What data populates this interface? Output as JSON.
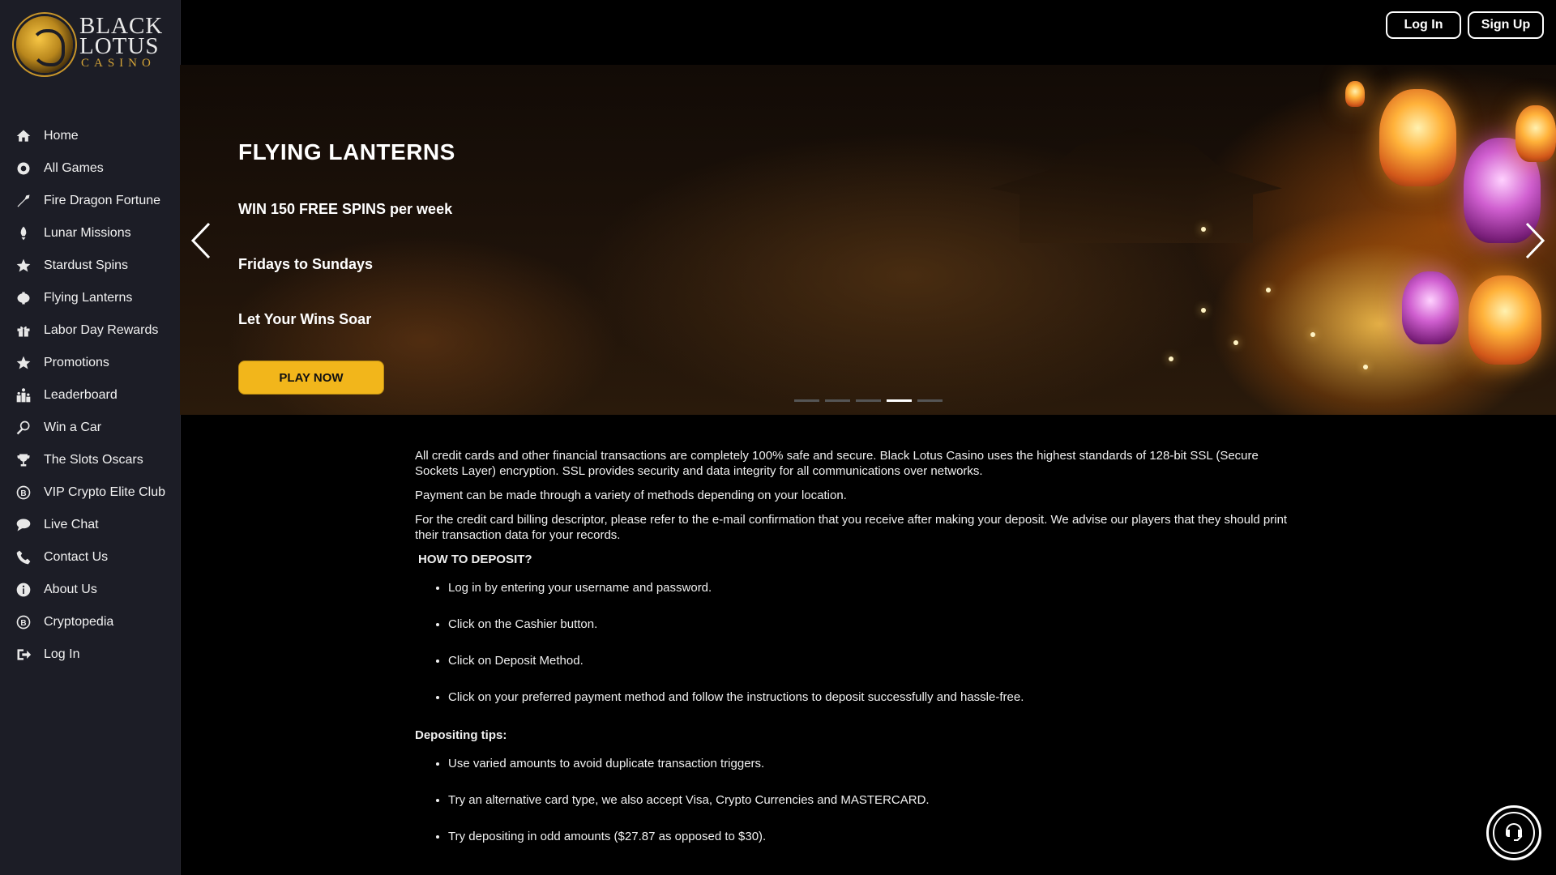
{
  "brand": {
    "name_line1": "BLACK",
    "name_line2": "LOTUS",
    "name_line3": "CASINO"
  },
  "header": {
    "login_label": "Log In",
    "signup_label": "Sign Up"
  },
  "sidebar": {
    "items": [
      {
        "label": "Home",
        "icon": "home-icon"
      },
      {
        "label": "All Games",
        "icon": "games-icon"
      },
      {
        "label": "Fire Dragon Fortune",
        "icon": "dragon-icon"
      },
      {
        "label": "Lunar Missions",
        "icon": "rocket-icon"
      },
      {
        "label": "Stardust Spins",
        "icon": "star-icon"
      },
      {
        "label": "Flying Lanterns",
        "icon": "lantern-icon"
      },
      {
        "label": "Labor Day Rewards",
        "icon": "gift-icon"
      },
      {
        "label": "Promotions",
        "icon": "star-icon"
      },
      {
        "label": "Leaderboard",
        "icon": "leaderboard-icon"
      },
      {
        "label": "Win a Car",
        "icon": "car-icon"
      },
      {
        "label": "The Slots Oscars",
        "icon": "trophy-icon"
      },
      {
        "label": "VIP Crypto Elite Club",
        "icon": "bitcoin-icon"
      },
      {
        "label": "Live Chat",
        "icon": "chat-icon"
      },
      {
        "label": "Contact Us",
        "icon": "phone-icon"
      },
      {
        "label": "About Us",
        "icon": "info-icon"
      },
      {
        "label": "Cryptopedia",
        "icon": "bitcoin-icon"
      },
      {
        "label": "Log In",
        "icon": "login-icon"
      }
    ]
  },
  "hero": {
    "title": "FLYING LANTERNS",
    "line1": "WIN 150 FREE SPINS per week",
    "line2": "Fridays to Sundays",
    "line3": "Let Your Wins Soar",
    "cta_label": "PLAY NOW",
    "slide_count": 5,
    "active_slide": 4
  },
  "content": {
    "para1": "All credit cards and other financial transactions are completely 100% safe and secure. Black Lotus Casino uses the highest standards of 128-bit SSL (Secure Sockets Layer) encryption. SSL provides security and data integrity for all communications over networks.",
    "para2": "Payment can be made through a variety of methods depending on your location.",
    "para3": "For the credit card billing descriptor, please refer to the e-mail confirmation that you receive after making your deposit. We advise our players that they should print their transaction data for your records.",
    "how_heading": "HOW TO DEPOSIT?",
    "steps": [
      "Log in by entering your username and password.",
      "Click on the Cashier button.",
      "Click on Deposit Method.",
      "Click on your preferred payment method and follow the instructions to deposit successfully and hassle-free."
    ],
    "tips_heading": "Depositing tips:",
    "tips": [
      "Use varied amounts to avoid duplicate transaction triggers.",
      "Try an alternative card type, we also accept Visa, Crypto Currencies and MASTERCARD.",
      "Try depositing in odd amounts ($27.87 as opposed to $30)."
    ]
  },
  "colors": {
    "accent": "#f2b61b",
    "sidebar_bg": "#1c1d26",
    "page_bg": "#000000"
  }
}
